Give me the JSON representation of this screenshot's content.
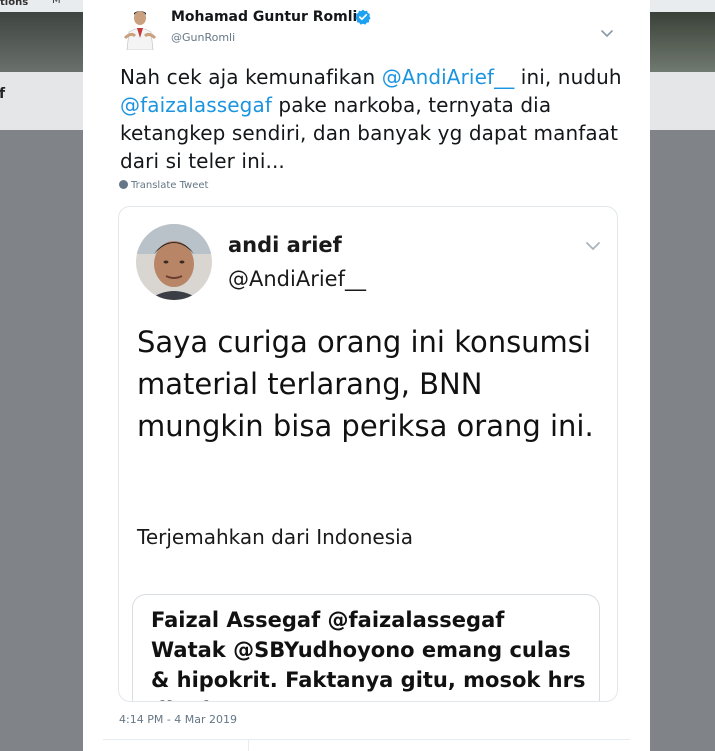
{
  "background": {
    "nav_fragment_left": "tions",
    "nav_fragment_right": "M",
    "name_fragment": "f"
  },
  "tweet": {
    "author_name": "Mohamad Guntur Romli",
    "author_handle": "@GunRomli",
    "verified": true,
    "text_parts": {
      "p1": "Nah cek aja kemunafikan ",
      "m1": "@AndiArief__",
      "p2": " ini, nuduh ",
      "m2": "@faizalassegaf",
      "p3": " pake narkoba, ternyata dia ketangkep sendiri, dan banyak yg dapat manfaat dari si teler ini..."
    },
    "translate_label": "Translate Tweet",
    "timestamp": "4:14 PM - 4 Mar 2019"
  },
  "embedded_image": {
    "author_name": "andi arief",
    "author_handle": "@AndiArief__",
    "body": "Saya curiga orang ini konsumsi material terlarang, BNN mungkin bisa periksa orang ini.",
    "translate_label": "Terjemahkan dari Indonesia",
    "quote": {
      "author": "Faizal Assegaf @faizalassegaf",
      "text": "Watak @SBYudhoyono emang culas & hipokrit. Faktanya gitu, mosok hrs dipoles"
    }
  },
  "colors": {
    "link": "#1b95e0",
    "verified": "#1da1f2",
    "muted": "#657786",
    "overlay": "#7f8488"
  },
  "icons": [
    "verified-badge-icon",
    "chevron-down-icon",
    "globe-icon"
  ]
}
